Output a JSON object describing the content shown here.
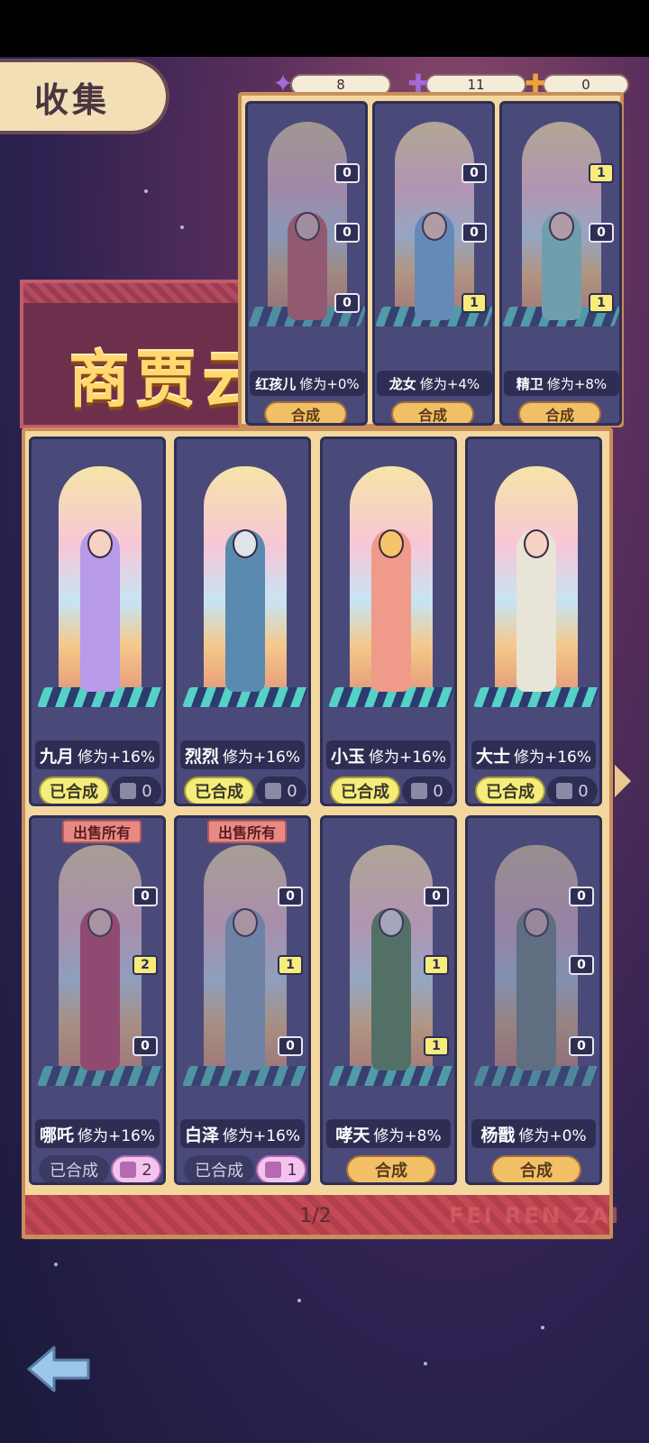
{
  "title": "收集",
  "banner_text": "商贾云",
  "currency": [
    {
      "icon": "ticket-icon",
      "value": "8",
      "color": "#a46ad8"
    },
    {
      "icon": "purple-puzzle-icon",
      "value": "11",
      "color": "#a46ad8"
    },
    {
      "icon": "orange-puzzle-icon",
      "value": "0",
      "color": "#f0a33a"
    }
  ],
  "popup_cards": [
    {
      "name": "红孩儿",
      "bonus": "修为+0%",
      "button": "合成",
      "badges": [
        "0",
        "0",
        "0"
      ],
      "char_color": "#d86a6a"
    },
    {
      "name": "龙女",
      "bonus": "修为+4%",
      "button": "合成",
      "badges": [
        "0",
        "0",
        "1"
      ],
      "char_color": "#7ab6e0"
    },
    {
      "name": "精卫",
      "bonus": "修为+8%",
      "button": "合成",
      "badges": [
        "1",
        "0",
        "1"
      ],
      "char_color": "#8cd6d0"
    }
  ],
  "cards_row1": [
    {
      "name": "九月",
      "bonus": "修为+16%",
      "status": "已合成",
      "fragments": "0",
      "char_color": "#b79ae8"
    },
    {
      "name": "烈烈",
      "bonus": "修为+16%",
      "status": "已合成",
      "fragments": "0",
      "char_color": "#5a8ab0"
    },
    {
      "name": "小玉",
      "bonus": "修为+16%",
      "status": "已合成",
      "fragments": "0",
      "char_color": "#f09a8a"
    },
    {
      "name": "大士",
      "bonus": "修为+16%",
      "status": "已合成",
      "fragments": "0",
      "char_color": "#e9e4d8"
    }
  ],
  "cards_row2": [
    {
      "name": "哪吒",
      "bonus": "修为+16%",
      "status": "已合成",
      "fragments": "2",
      "sell": "出售所有",
      "badges": [
        "0",
        "2",
        "0"
      ],
      "char_color": "#c84a6a"
    },
    {
      "name": "白泽",
      "bonus": "修为+16%",
      "status": "已合成",
      "fragments": "1",
      "sell": "出售所有",
      "badges": [
        "0",
        "1",
        "0"
      ],
      "char_color": "#8ab0c8"
    },
    {
      "name": "哮天",
      "bonus": "修为+8%",
      "button": "合成",
      "badges": [
        "0",
        "1",
        "1"
      ],
      "char_color": "#5a8a5a"
    },
    {
      "name": "杨戬",
      "bonus": "修为+0%",
      "button": "合成",
      "badges": [
        "0",
        "0",
        "0"
      ],
      "char_color": "#7a9a8a"
    }
  ],
  "pagination": "1/2",
  "brand_mark": "FEI REN ZAI"
}
